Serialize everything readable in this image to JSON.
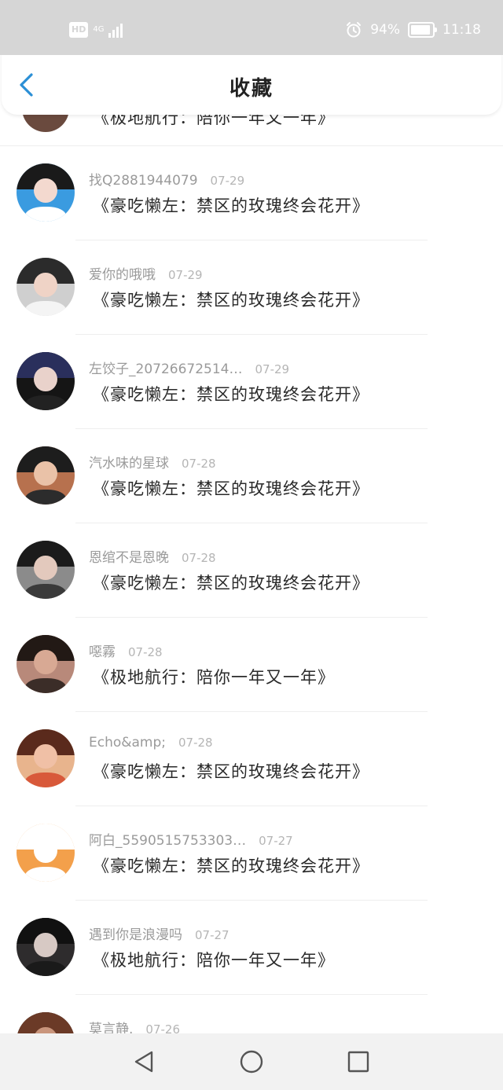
{
  "status_bar": {
    "hd": "HD",
    "network": "4G",
    "battery_percent": "94%",
    "battery_level": 0.94,
    "time": "11:18",
    "icons": [
      "hd-icon",
      "signal-icon",
      "alarm-icon",
      "battery-icon"
    ]
  },
  "header": {
    "title": "收藏",
    "back_icon": "chevron-left-icon",
    "accent_color": "#2b8fd6"
  },
  "list": {
    "partial_top_text": "《极地航行：陪你一年又一年》",
    "items": [
      {
        "name": "找Q2881944079",
        "date": "07-29",
        "message": "《豪吃懒左：禁区的玫瑰终会花开》"
      },
      {
        "name": "爱你的哦哦",
        "date": "07-29",
        "message": "《豪吃懒左：禁区的玫瑰终会花开》"
      },
      {
        "name": "左饺子_20726672514…",
        "date": "07-29",
        "message": "《豪吃懒左：禁区的玫瑰终会花开》"
      },
      {
        "name": "汽水味的星球",
        "date": "07-28",
        "message": "《豪吃懒左：禁区的玫瑰终会花开》"
      },
      {
        "name": "恩绾不是恩晚",
        "date": "07-28",
        "message": "《豪吃懒左：禁区的玫瑰终会花开》"
      },
      {
        "name": "噁霧",
        "date": "07-28",
        "message": "《极地航行：陪你一年又一年》"
      },
      {
        "name": "Echo&amp;",
        "date": "07-28",
        "message": "《豪吃懒左：禁区的玫瑰终会花开》"
      },
      {
        "name": "阿白_5590515753303…",
        "date": "07-27",
        "message": "《豪吃懒左：禁区的玫瑰终会花开》"
      },
      {
        "name": "遇到你是浪漫吗",
        "date": "07-27",
        "message": "《极地航行：陪你一年又一年》"
      },
      {
        "name": "莫言静.",
        "date": "07-26",
        "message": ""
      }
    ]
  },
  "nav_bar": {
    "icons": [
      "back-triangle-icon",
      "home-circle-icon",
      "recents-square-icon"
    ]
  }
}
